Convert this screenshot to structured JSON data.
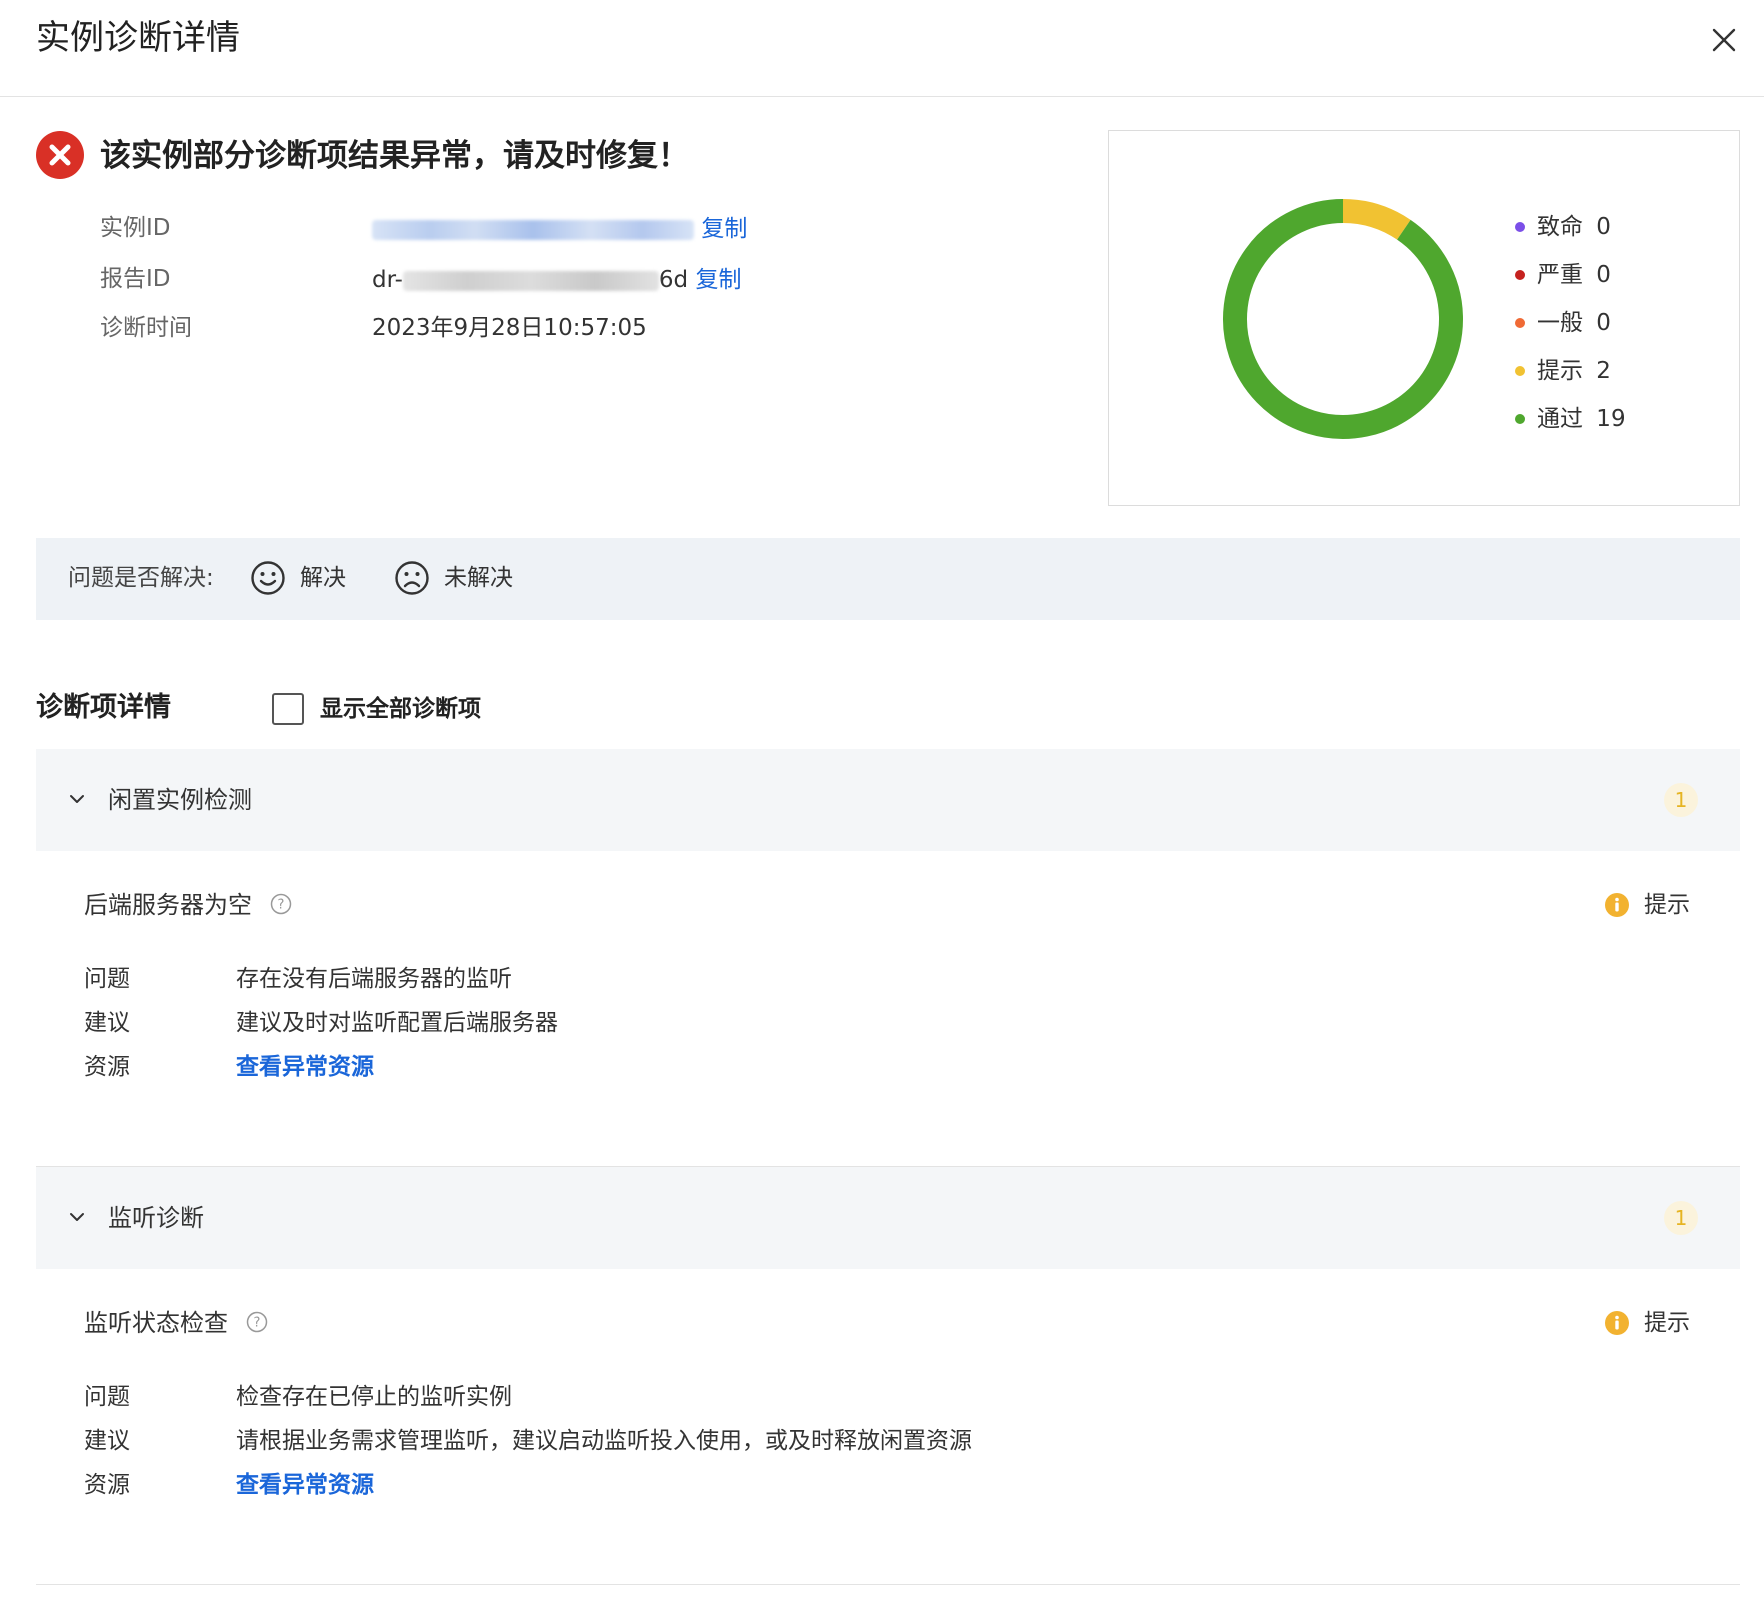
{
  "header": {
    "title": "实例诊断详情",
    "close_icon": "close-icon"
  },
  "summary": {
    "status_icon": "error-circle-icon",
    "status_color": "#d93026",
    "status_text": "该实例部分诊断项结果异常，请及时修复！",
    "instance_id_label": "实例ID",
    "instance_id_fragment": "yg",
    "report_id_label": "报告ID",
    "report_id_prefix": "dr-",
    "report_id_suffix": "6d",
    "copy_label": "复制",
    "time_label": "诊断时间",
    "time_value": "2023年9月28日10:57:05"
  },
  "chart_data": {
    "type": "pie",
    "style": "donut",
    "categories": [
      "致命",
      "严重",
      "一般",
      "提示",
      "通过"
    ],
    "values": [
      0,
      0,
      0,
      2,
      19
    ],
    "colors": [
      "#7b4fe8",
      "#c5221f",
      "#f06a35",
      "#f1c232",
      "#4fa72e"
    ],
    "legend_position": "right"
  },
  "legend": {
    "items": [
      {
        "label": "致命",
        "value": "0",
        "color": "#7b4fe8"
      },
      {
        "label": "严重",
        "value": "0",
        "color": "#c5221f"
      },
      {
        "label": "一般",
        "value": "0",
        "color": "#f06a35"
      },
      {
        "label": "提示",
        "value": "2",
        "color": "#f1c232"
      },
      {
        "label": "通过",
        "value": "19",
        "color": "#4fa72e"
      }
    ]
  },
  "feedback": {
    "label": "问题是否解决:",
    "resolved": "解决",
    "unresolved": "未解决",
    "resolved_icon": "smile-icon",
    "unresolved_icon": "frown-icon"
  },
  "details": {
    "title": "诊断项详情",
    "show_all_label": "显示全部诊断项",
    "show_all_checked": false
  },
  "groups": [
    {
      "title": "闲置实例检测",
      "count": "1",
      "item": {
        "title": "后端服务器为空",
        "level_label": "提示",
        "level_icon": "info-icon",
        "problem_label": "问题",
        "problem": "存在没有后端服务器的监听",
        "advice_label": "建议",
        "advice": "建议及时对监听配置后端服务器",
        "resource_label": "资源",
        "resource_link": "查看异常资源"
      }
    },
    {
      "title": "监听诊断",
      "count": "1",
      "item": {
        "title": "监听状态检查",
        "level_label": "提示",
        "level_icon": "info-icon",
        "problem_label": "问题",
        "problem": "检查存在已停止的监听实例",
        "advice_label": "建议",
        "advice": "请根据业务需求管理监听，建议启动监听投入使用，或及时释放闲置资源",
        "resource_label": "资源",
        "resource_link": "查看异常资源"
      }
    }
  ],
  "colors": {
    "accent": "#1a66d9",
    "warning": "#f2b230",
    "panel_bg": "#eef2f6"
  }
}
